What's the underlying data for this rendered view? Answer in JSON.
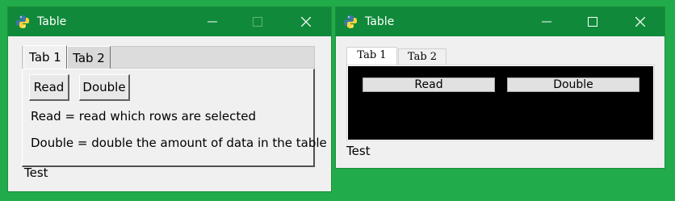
{
  "colors": {
    "desktop": "#22ab4a",
    "titlebar": "#108a3a",
    "window_bg": "#f0f0f0",
    "dark_panel": "#000000"
  },
  "window_left": {
    "title": "Table",
    "app_icon": "python-icon",
    "controls": [
      "minimize-icon",
      "maximize-icon",
      "close-icon"
    ],
    "tabs": [
      {
        "label": "Tab 1",
        "active": true
      },
      {
        "label": "Tab 2",
        "active": false
      }
    ],
    "buttons": {
      "read": "Read",
      "double": "Double"
    },
    "descriptions": [
      "Read = read which rows are selected",
      "Double = double the amount of data in the table"
    ],
    "status": "Test"
  },
  "window_right": {
    "title": "Table",
    "app_icon": "python-icon",
    "controls": [
      "minimize-icon",
      "maximize-icon",
      "close-icon"
    ],
    "tabs": [
      {
        "label": "Tab 1",
        "active": true
      },
      {
        "label": "Tab 2",
        "active": false
      }
    ],
    "buttons": {
      "read": "Read",
      "double": "Double"
    },
    "status": "Test"
  }
}
